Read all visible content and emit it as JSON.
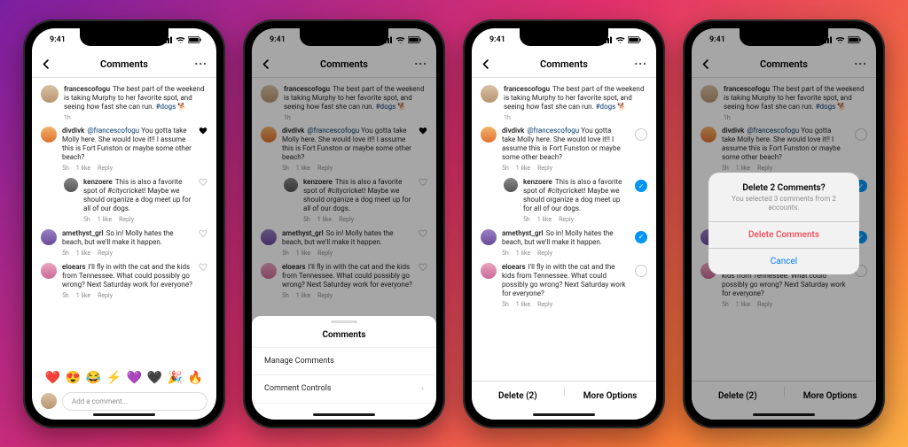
{
  "status": {
    "time": "9:41"
  },
  "nav": {
    "title": "Comments",
    "more": "···"
  },
  "post": {
    "username": "francescofogu",
    "text": "The best part of the weekend is taking Murphy to her favorite spot, and seeing how fast she can run.",
    "hashtag": "#dogs",
    "emoji": "🐕",
    "time": "1h"
  },
  "comments": [
    {
      "username": "divdivk",
      "mention": "@francescofogu",
      "text": "You gotta take Molly here. She would love it!! I assume this is Fort Funston or maybe some other beach?",
      "time": "5h",
      "likes": "1 like",
      "reply": "Reply",
      "liked": true
    },
    {
      "username": "kenzoere",
      "text": "This is also a favorite spot of #citycricket! Maybe we should organize a dog meet up for all of our dogs.",
      "time": "5h",
      "likes": "1 like",
      "reply": "Reply",
      "nested": true
    },
    {
      "username": "amethyst_grl",
      "text": "So in! Molly hates the beach, but we'll make it happen.",
      "time": "5h",
      "likes": "1 like",
      "reply": "Reply"
    },
    {
      "username": "eloears",
      "text": "I'll fly in with the cat and the kids from Tennessee. What could possibly go wrong? Next Saturday work for everyone?",
      "time": "5h",
      "likes": "1 like",
      "reply": "Reply"
    }
  ],
  "emoji_row": [
    "❤️",
    "😍",
    "😂",
    "⚡",
    "💜",
    "🖤",
    "🎉",
    "🔥"
  ],
  "composer": {
    "placeholder": "Add a comment..."
  },
  "sheet": {
    "title": "Comments",
    "items": [
      "Manage Comments",
      "Comment Controls"
    ]
  },
  "bottom": {
    "delete": "Delete (2)",
    "more": "More Options"
  },
  "alert": {
    "title": "Delete 2 Comments?",
    "msg": "You selected 3 comments from 2 accounts.",
    "delete": "Delete Comments",
    "cancel": "Cancel"
  }
}
